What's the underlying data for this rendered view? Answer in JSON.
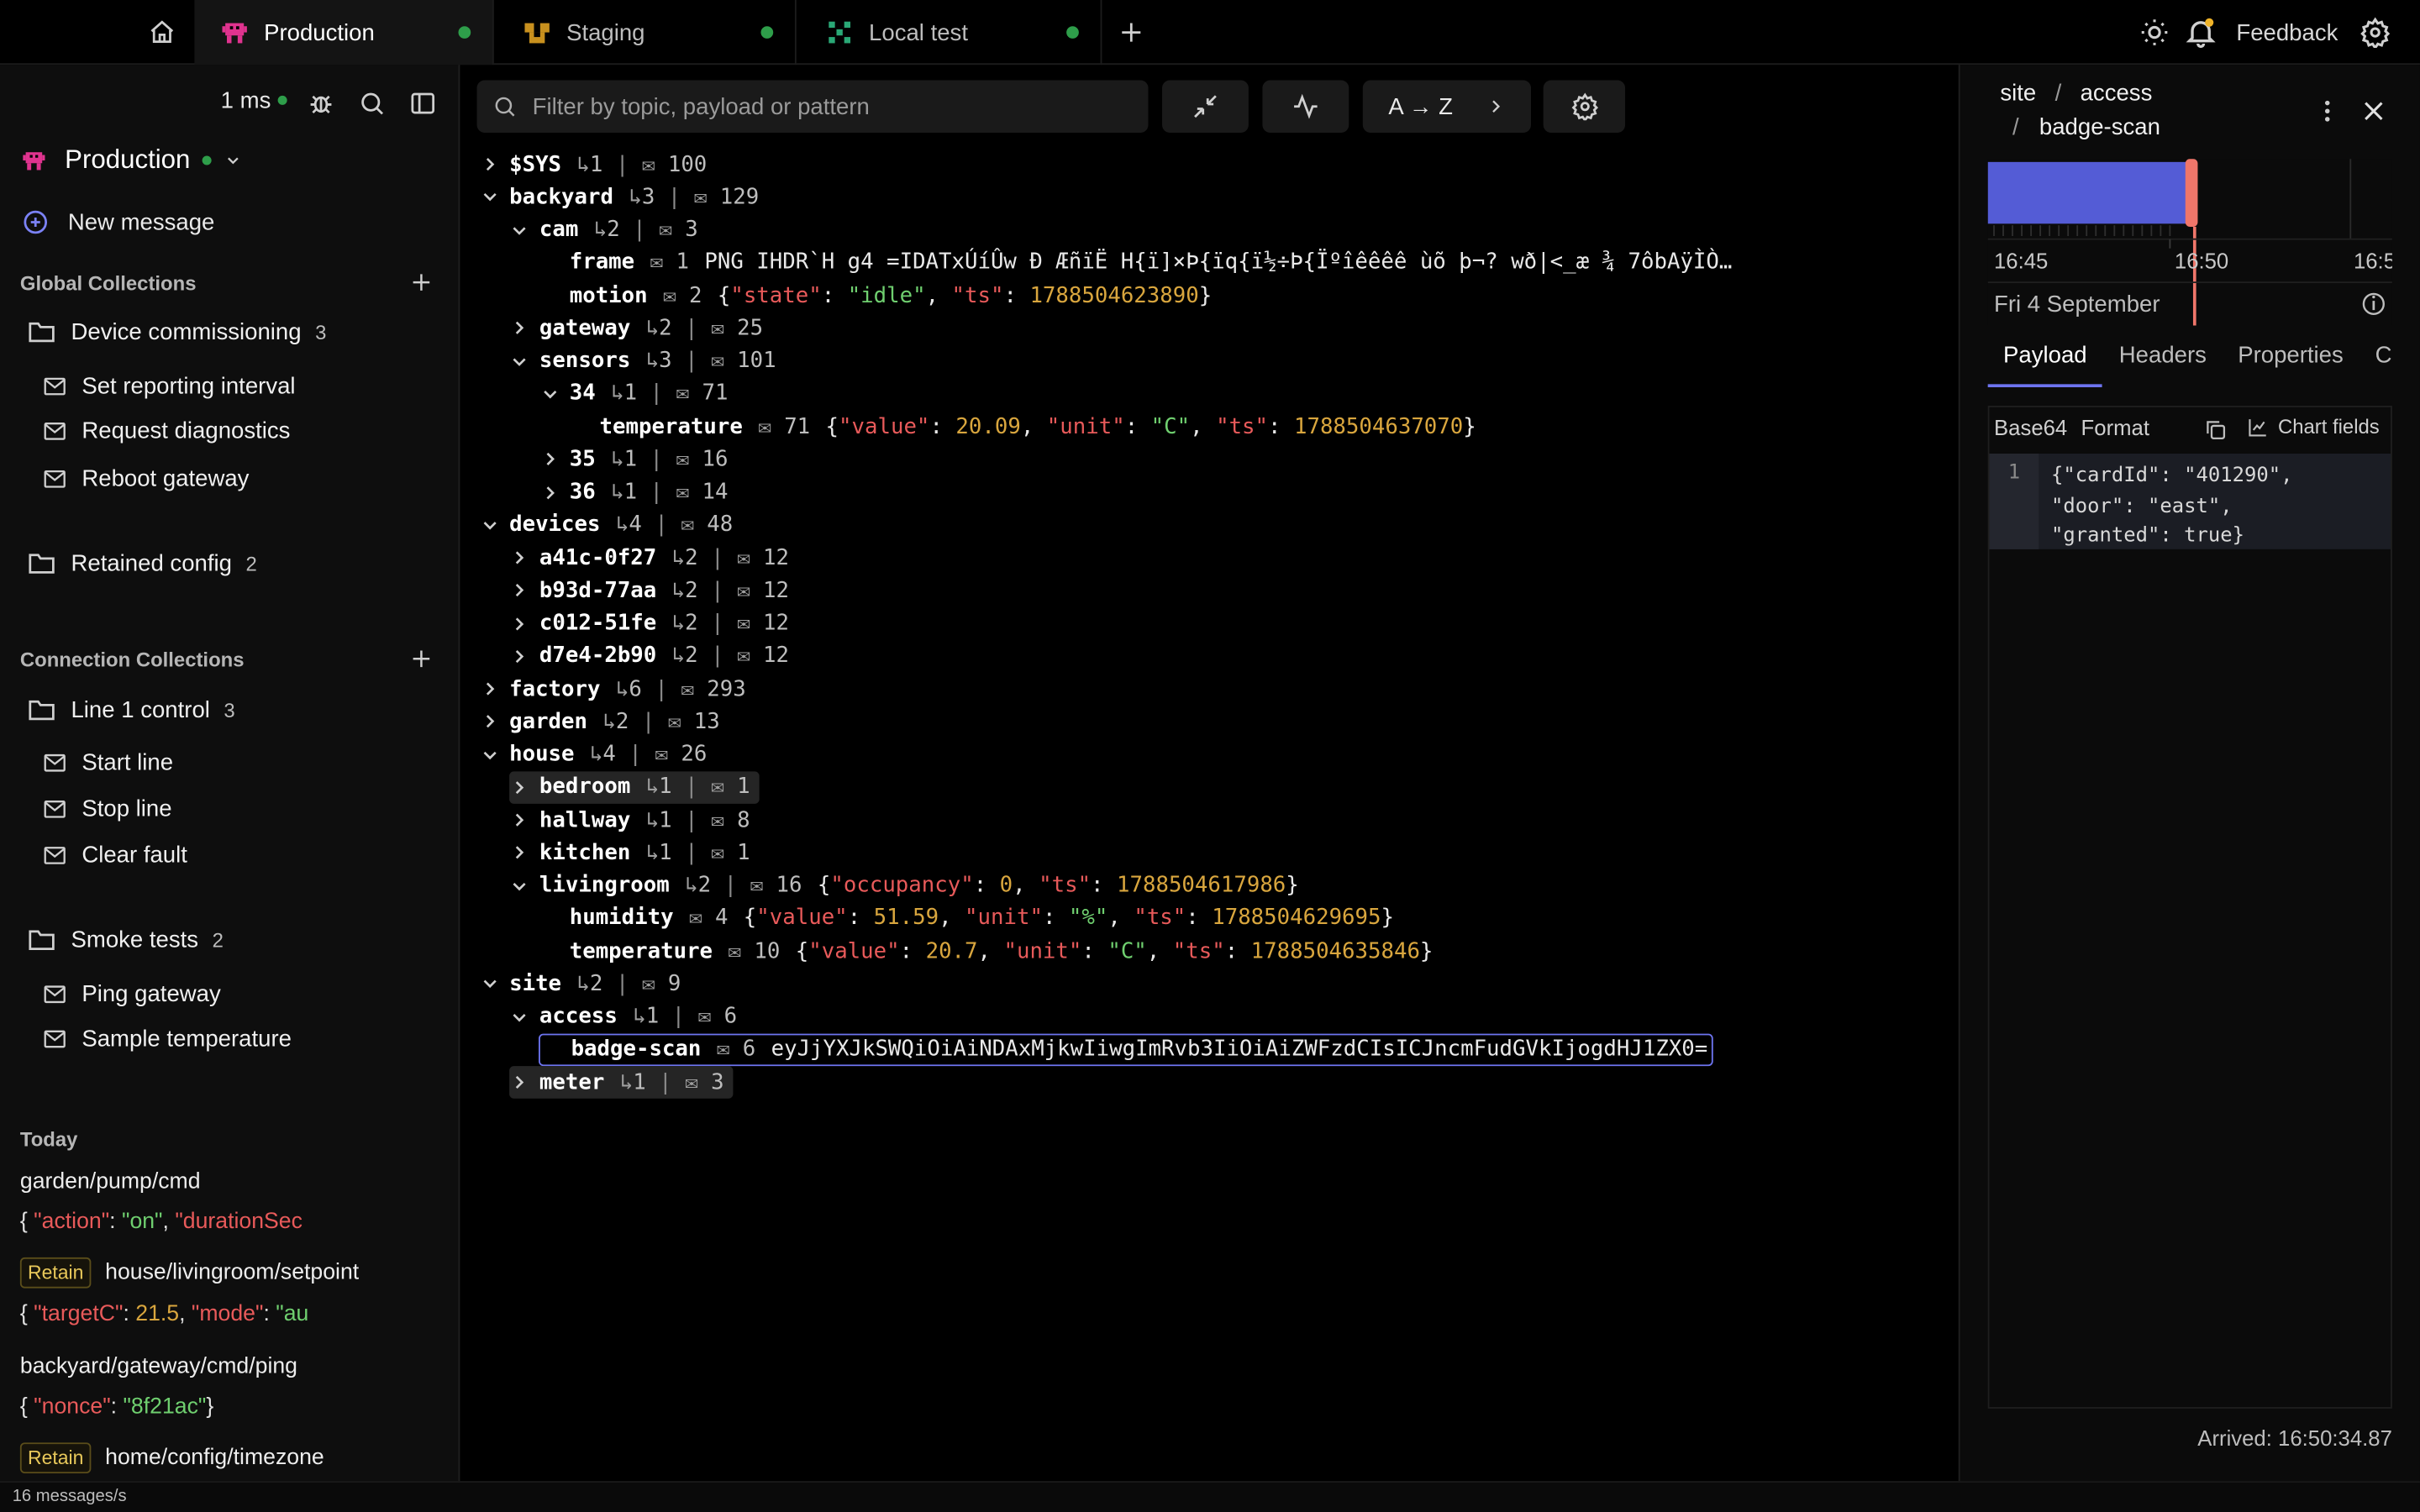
{
  "tabs": [
    {
      "label": "Production",
      "active": true
    },
    {
      "label": "Staging",
      "active": false
    },
    {
      "label": "Local test",
      "active": false
    }
  ],
  "topbar": {
    "feedback": "Feedback"
  },
  "sidebar": {
    "latency": "1 ms",
    "connection": "Production",
    "new_message": "New message",
    "global_title": "Global Collections",
    "global_folders": [
      {
        "name": "Device commissioning",
        "count": "3",
        "items": [
          "Set reporting interval",
          "Request diagnostics",
          "Reboot gateway"
        ]
      },
      {
        "name": "Retained config",
        "count": "2",
        "items": []
      }
    ],
    "connection_title": "Connection Collections",
    "connection_folders": [
      {
        "name": "Line 1 control",
        "count": "3",
        "items": [
          "Start line",
          "Stop line",
          "Clear fault"
        ]
      },
      {
        "name": "Smoke tests",
        "count": "2",
        "items": [
          "Ping gateway",
          "Sample temperature"
        ]
      }
    ],
    "history_title": "Today",
    "history": [
      {
        "retain": "",
        "topic": "garden/pump/cmd",
        "payload": "{ \"action\": \"on\", \"durationSec"
      },
      {
        "retain": "Retain",
        "topic": "house/livingroom/setpoint",
        "payload": "{ \"targetC\": 21.5, \"mode\": \"au"
      },
      {
        "retain": "",
        "topic": "backyard/gateway/cmd/ping",
        "payload": "{ \"nonce\": \"8f21ac\"}"
      },
      {
        "retain": "Retain",
        "topic": "home/config/timezone",
        "payload": ""
      }
    ],
    "status": "16 messages/s"
  },
  "toolbar": {
    "search_placeholder": "Filter by topic, payload or pattern",
    "sort_label": "A → Z"
  },
  "tree": [
    {
      "depth": 0,
      "chev": "right",
      "name": "$SYS",
      "sub": "1",
      "msgs": "100",
      "payload": ""
    },
    {
      "depth": 0,
      "chev": "down",
      "name": "backyard",
      "sub": "3",
      "msgs": "129",
      "payload": ""
    },
    {
      "depth": 1,
      "chev": "down",
      "name": "cam",
      "sub": "2",
      "msgs": "3",
      "payload": ""
    },
    {
      "depth": 2,
      "chev": "",
      "name": "frame",
      "sub": "",
      "msgs": "1",
      "payload": "  PNG   IHDR`H   g4 =IDATxÚíÛw  Ð ÆñïË    H{ï]×Þ{ïq{ï½÷Þ{Ïºîêêêê     ùõ  þ¬?  wð|<_æ  ¾  7ôbAÿÌÒ…"
    },
    {
      "depth": 2,
      "chev": "",
      "name": "motion",
      "sub": "",
      "msgs": "2",
      "payload": "{\"state\": \"idle\", \"ts\": 1788504623890}"
    },
    {
      "depth": 1,
      "chev": "right",
      "name": "gateway",
      "sub": "2",
      "msgs": "25",
      "payload": ""
    },
    {
      "depth": 1,
      "chev": "down",
      "name": "sensors",
      "sub": "3",
      "msgs": "101",
      "payload": ""
    },
    {
      "depth": 2,
      "chev": "down",
      "name": "34",
      "sub": "1",
      "msgs": "71",
      "payload": ""
    },
    {
      "depth": 3,
      "chev": "",
      "name": "temperature",
      "sub": "",
      "msgs": "71",
      "payload": "{\"value\": 20.09, \"unit\": \"C\", \"ts\": 1788504637070}"
    },
    {
      "depth": 2,
      "chev": "right",
      "name": "35",
      "sub": "1",
      "msgs": "16",
      "payload": ""
    },
    {
      "depth": 2,
      "chev": "right",
      "name": "36",
      "sub": "1",
      "msgs": "14",
      "payload": ""
    },
    {
      "depth": 0,
      "chev": "down",
      "name": "devices",
      "sub": "4",
      "msgs": "48",
      "payload": ""
    },
    {
      "depth": 1,
      "chev": "right",
      "name": "a41c-0f27",
      "sub": "2",
      "msgs": "12",
      "payload": ""
    },
    {
      "depth": 1,
      "chev": "right",
      "name": "b93d-77aa",
      "sub": "2",
      "msgs": "12",
      "payload": ""
    },
    {
      "depth": 1,
      "chev": "right",
      "name": "c012-51fe",
      "sub": "2",
      "msgs": "12",
      "payload": ""
    },
    {
      "depth": 1,
      "chev": "right",
      "name": "d7e4-2b90",
      "sub": "2",
      "msgs": "12",
      "payload": ""
    },
    {
      "depth": 0,
      "chev": "right",
      "name": "factory",
      "sub": "6",
      "msgs": "293",
      "payload": ""
    },
    {
      "depth": 0,
      "chev": "right",
      "name": "garden",
      "sub": "2",
      "msgs": "13",
      "payload": ""
    },
    {
      "depth": 0,
      "chev": "down",
      "name": "house",
      "sub": "4",
      "msgs": "26",
      "payload": ""
    },
    {
      "depth": 1,
      "chev": "right",
      "name": "bedroom",
      "sub": "1",
      "msgs": "1",
      "payload": "",
      "hl": true
    },
    {
      "depth": 1,
      "chev": "right",
      "name": "hallway",
      "sub": "1",
      "msgs": "8",
      "payload": ""
    },
    {
      "depth": 1,
      "chev": "right",
      "name": "kitchen",
      "sub": "1",
      "msgs": "1",
      "payload": ""
    },
    {
      "depth": 1,
      "chev": "down",
      "name": "livingroom",
      "sub": "2",
      "msgs": "16",
      "payload": "{\"occupancy\": 0, \"ts\": 1788504617986}"
    },
    {
      "depth": 2,
      "chev": "",
      "name": "humidity",
      "sub": "",
      "msgs": "4",
      "payload": "{\"value\": 51.59, \"unit\": \"%\", \"ts\": 1788504629695}"
    },
    {
      "depth": 2,
      "chev": "",
      "name": "temperature",
      "sub": "",
      "msgs": "10",
      "payload": "{\"value\": 20.7, \"unit\": \"C\", \"ts\": 1788504635846}"
    },
    {
      "depth": 0,
      "chev": "down",
      "name": "site",
      "sub": "2",
      "msgs": "9",
      "payload": ""
    },
    {
      "depth": 1,
      "chev": "down",
      "name": "access",
      "sub": "1",
      "msgs": "6",
      "payload": ""
    },
    {
      "depth": 2,
      "chev": "",
      "name": "badge-scan",
      "sub": "",
      "msgs": "6",
      "payload": "eyJjYXJkSWQiOiAiNDAxMjkwIiwgImRvb3IiOiAiZWFzdCIsICJncmFudGVkIjogdHJ1ZX0=",
      "sel": true
    },
    {
      "depth": 1,
      "chev": "right",
      "name": "meter",
      "sub": "1",
      "msgs": "3",
      "payload": "",
      "hl": true
    }
  ],
  "details": {
    "breadcrumb": [
      "site",
      "access",
      "badge-scan"
    ],
    "timeline_ticks": [
      "16:45",
      "16:50",
      "16:5"
    ],
    "date": "Fri 4 September",
    "tabs": [
      "Payload",
      "Headers",
      "Properties",
      "C"
    ],
    "base64_label": "Base64",
    "format_label": "Format",
    "chart_fields": "Chart fields",
    "line_no": "1",
    "code_lines": [
      "{\"cardId\": \"401290\",",
      "\"door\": \"east\",",
      "\"granted\": true}"
    ],
    "arrived": "Arrived: 16:50:34.87"
  },
  "colors": {
    "accent": "#6d74f0",
    "brand": "#e0338f",
    "online": "#2e9e4a",
    "marker": "#f0766a"
  }
}
